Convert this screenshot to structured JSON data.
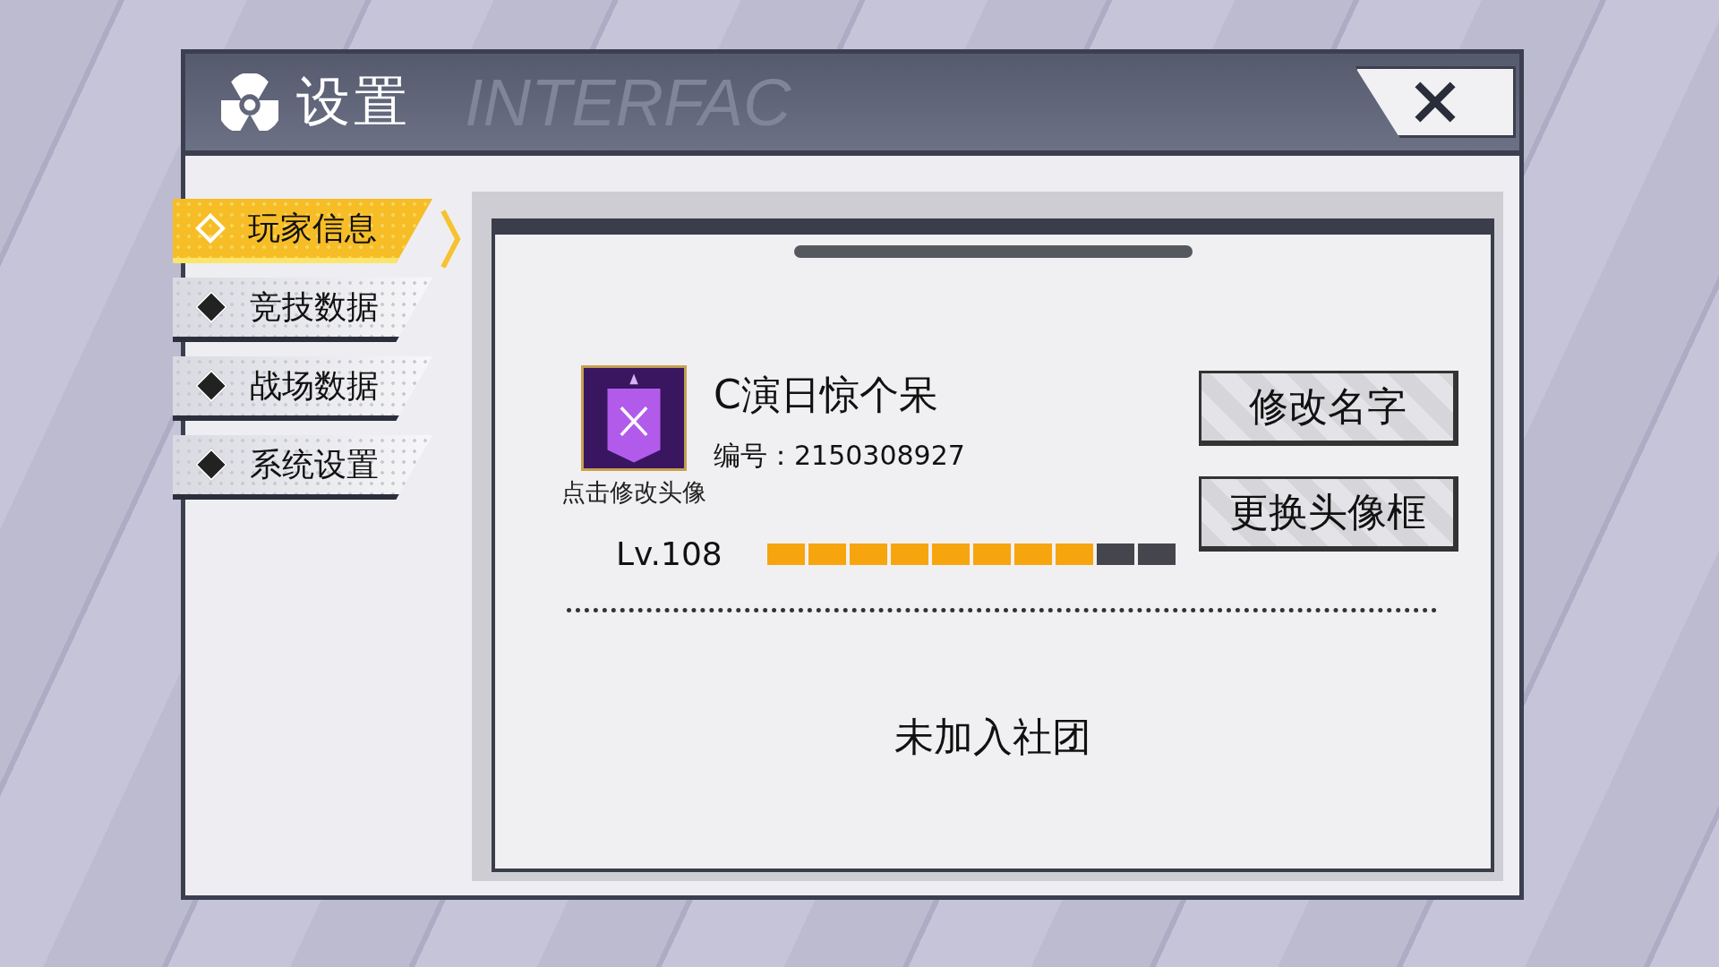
{
  "window": {
    "title": "设置",
    "decoration": "INTERFAC"
  },
  "sidebar": {
    "items": [
      {
        "label": "玩家信息",
        "selected": true
      },
      {
        "label": "竞技数据",
        "selected": false
      },
      {
        "label": "战场数据",
        "selected": false
      },
      {
        "label": "系统设置",
        "selected": false
      }
    ]
  },
  "profile": {
    "name": "C演日惊个呆",
    "id_label": "编号：2150308927",
    "avatar_hint": "点击修改头像",
    "level_label": "Lv.108",
    "level": 0.8,
    "buttons": [
      "修改名字",
      "更换头像框"
    ]
  },
  "club": "未加入社团"
}
